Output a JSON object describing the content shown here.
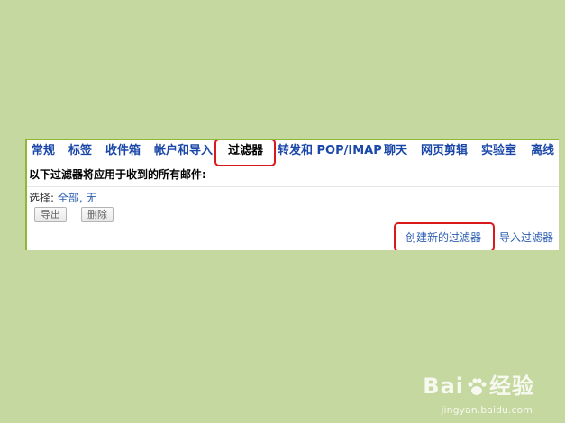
{
  "tabs": [
    {
      "label": "常规",
      "active": false
    },
    {
      "label": "标签",
      "active": false
    },
    {
      "label": "收件箱",
      "active": false
    },
    {
      "label": "帐户和导入",
      "active": false
    },
    {
      "label": "过滤器",
      "active": true
    },
    {
      "label": "转发和 POP/IMAP",
      "active": false
    },
    {
      "label": "聊天",
      "active": false
    },
    {
      "label": "网页剪辑",
      "active": false
    },
    {
      "label": "实验室",
      "active": false
    },
    {
      "label": "离线",
      "active": false
    }
  ],
  "description": "以下过滤器将应用于收到的所有邮件:",
  "select": {
    "label": "选择:",
    "all": "全部",
    "separator": ",",
    "none": "无"
  },
  "buttons": {
    "export": "导出",
    "delete": "删除"
  },
  "links": {
    "create_filter": "创建新的过滤器",
    "import_filters": "导入过滤器"
  },
  "watermark": {
    "brand_left": "Bai",
    "brand_right": "经验",
    "url": "jingyan.baidu.com"
  },
  "colors": {
    "background": "#c5d89f",
    "tab_link": "#1a47a8",
    "link": "#2a5db0",
    "highlight": "#d81a1a"
  }
}
